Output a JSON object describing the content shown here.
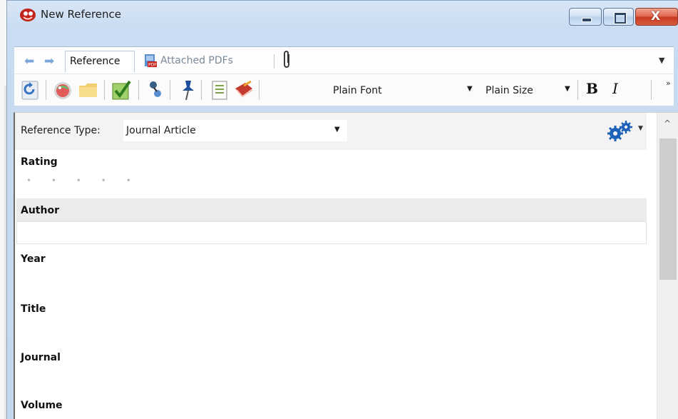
{
  "window": {
    "title": "New Reference",
    "close_glyph": "X"
  },
  "nav": {
    "back_glyph": "⬅",
    "forward_glyph": "➡"
  },
  "tabs": {
    "reference": "Reference",
    "attached_pdfs": "Attached PDFs",
    "overflow_glyph": "▼"
  },
  "toolbar": {
    "font_name": "Plain Font",
    "font_size": "Plain Size",
    "bold_label": "B",
    "italic_label": "I",
    "more_glyph": "»",
    "dropdown_glyph": "▼"
  },
  "reference_type": {
    "label": "Reference Type:",
    "value": "Journal Article"
  },
  "fields": {
    "rating": "Rating",
    "rating_dots": "• • • • •",
    "author": "Author",
    "year": "Year",
    "title": "Title",
    "journal": "Journal",
    "volume": "Volume"
  },
  "scrollbar": {
    "up_glyph": "^"
  },
  "icons": {
    "app": "endnote-app-icon",
    "pdf": "pdf-icon",
    "clip": "paperclip-icon",
    "gear": "gears-icon"
  },
  "colors": {
    "frame": "#c9dcf1",
    "close_red": "#d65c3e",
    "nav_blue": "#7aa7d8",
    "gear_blue": "#1c63b8"
  }
}
